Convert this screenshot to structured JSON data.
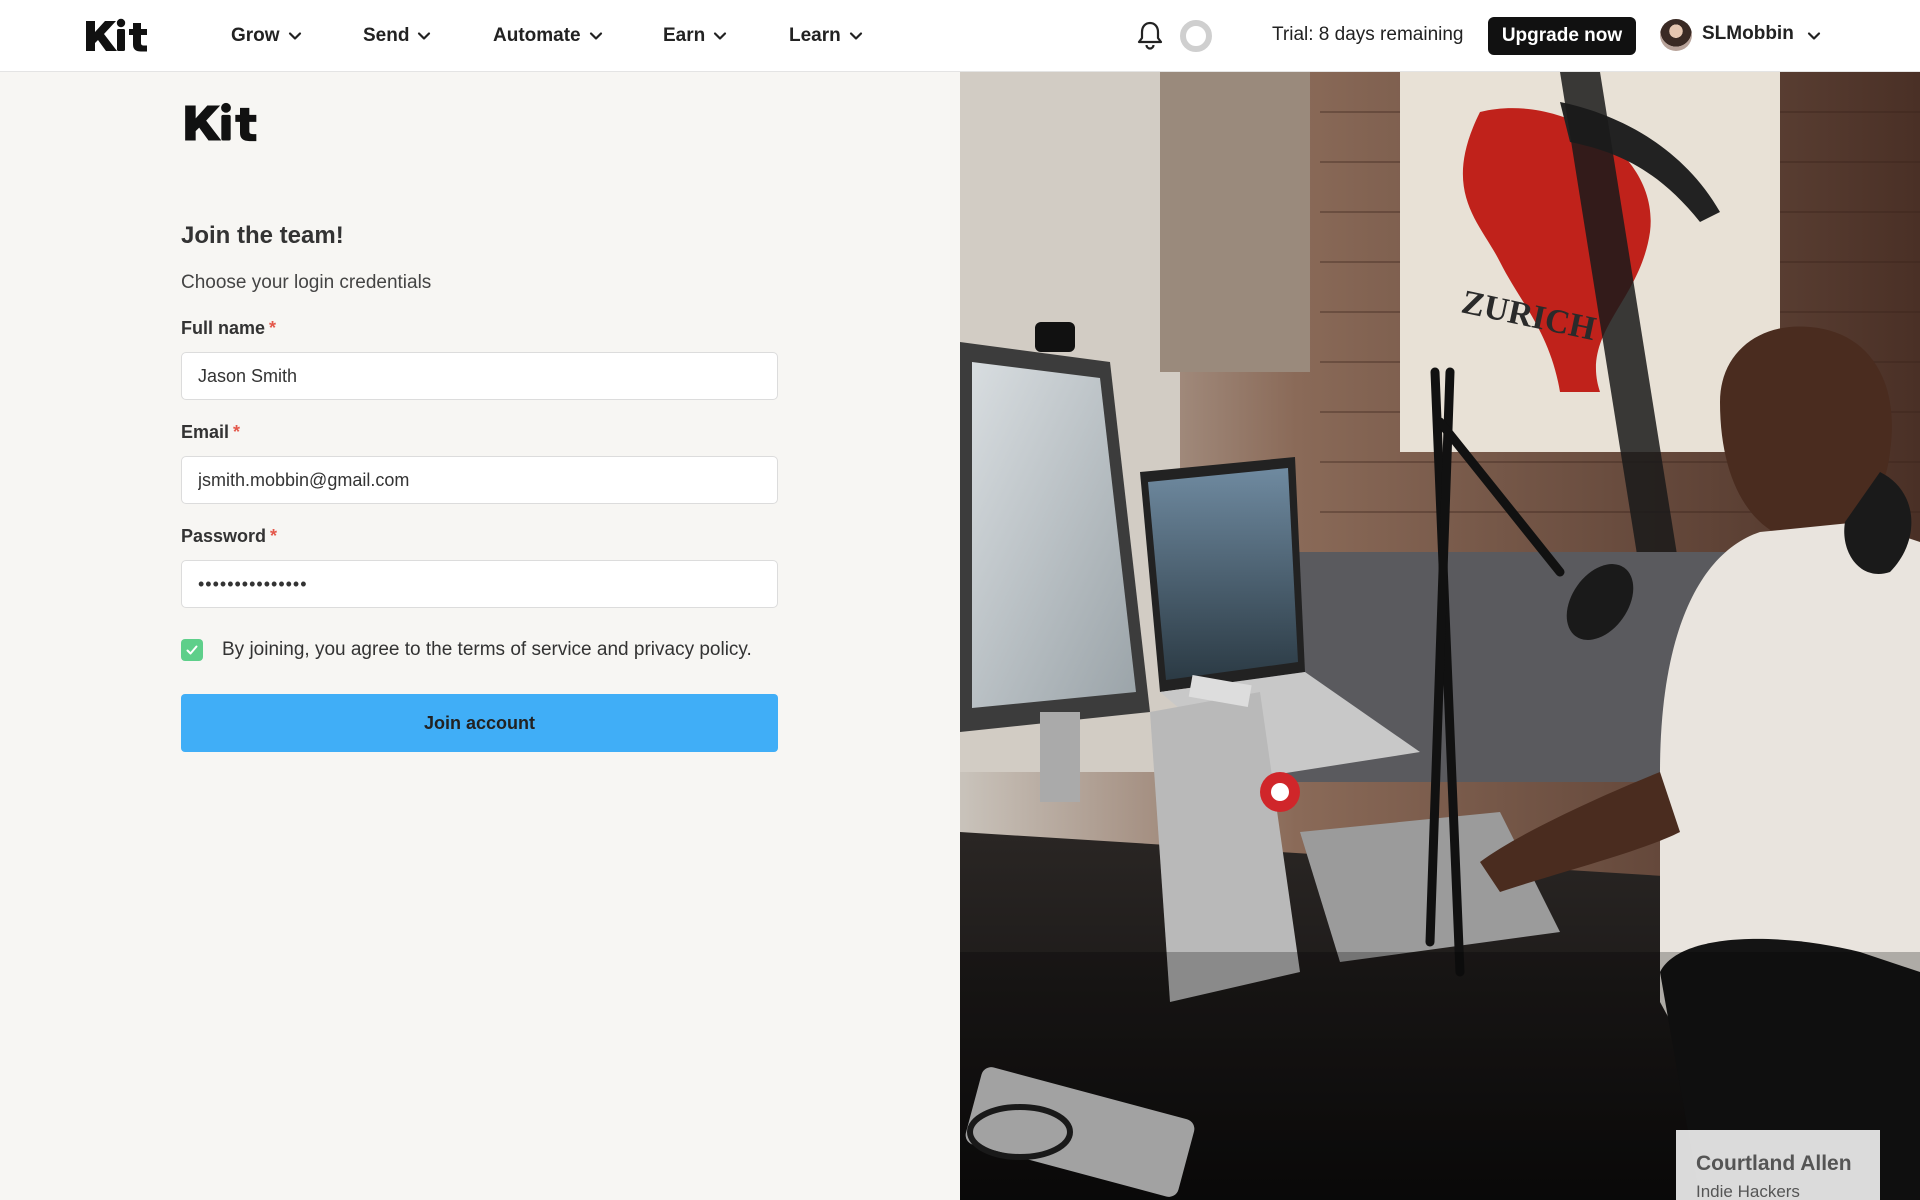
{
  "nav": {
    "brand": "Kit",
    "items": [
      {
        "label": "Grow"
      },
      {
        "label": "Send"
      },
      {
        "label": "Automate"
      },
      {
        "label": "Earn"
      },
      {
        "label": "Learn"
      }
    ],
    "trial_text": "Trial: 8 days remaining",
    "upgrade_label": "Upgrade now",
    "username": "SLMobbin",
    "icons": [
      "bell-icon",
      "loading-spinner-icon",
      "chevron-down-icon"
    ]
  },
  "form": {
    "logo": "Kit",
    "heading": "Join the team!",
    "subheading": "Choose your login credentials",
    "full_name_label": "Full name",
    "full_name_value": "Jason Smith",
    "email_label": "Email",
    "email_value": "jsmith.mobbin@gmail.com",
    "password_label": "Password",
    "password_value": "•••••••••••••••",
    "required_marker": "*",
    "terms_checked": true,
    "terms_text": "By joining, you agree to the terms of service and privacy policy.",
    "submit_label": "Join account"
  },
  "photo": {
    "caption_name": "Courtland Allen",
    "caption_role": "Indie Hackers"
  },
  "colors": {
    "accent": "#40aef7",
    "checkbox": "#5ecf8a",
    "required": "#e4584b",
    "upgrade_bg": "#111111"
  }
}
